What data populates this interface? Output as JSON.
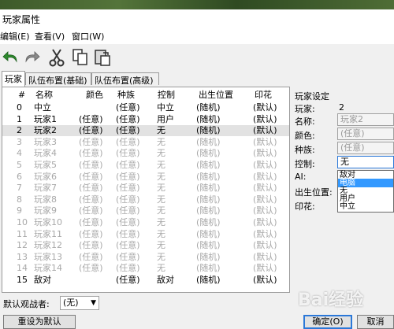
{
  "window": {
    "title": "玩家属性"
  },
  "menu": [
    "编辑(E)",
    "查看(V)",
    "窗口(W)"
  ],
  "toolbar": {
    "icons": [
      "undo-icon",
      "redo-icon",
      "cut-icon",
      "copy-icon",
      "paste-icon"
    ]
  },
  "tabs": [
    "玩家",
    "队伍布置(基础)",
    "队伍布置(高级)"
  ],
  "table": {
    "headers": [
      "#",
      "名称",
      "颜色",
      "种族",
      "控制",
      "出生位置",
      "印花"
    ],
    "rows": [
      {
        "num": "0",
        "name": "中立",
        "color": "",
        "race": "(任意)",
        "control": "中立",
        "start": "(随机)",
        "decal": "(默认)"
      },
      {
        "num": "1",
        "name": "玩家1",
        "color": "(任意)",
        "race": "(任意)",
        "control": "用户",
        "start": "(随机)",
        "decal": "(默认)"
      },
      {
        "num": "2",
        "name": "玩家2",
        "color": "(任意)",
        "race": "(任意)",
        "control": "无",
        "start": "(随机)",
        "decal": "(默认)"
      },
      {
        "num": "3",
        "name": "玩家3",
        "color": "(任意)",
        "race": "(任意)",
        "control": "无",
        "start": "(随机)",
        "decal": "(默认)"
      },
      {
        "num": "4",
        "name": "玩家4",
        "color": "(任意)",
        "race": "(任意)",
        "control": "无",
        "start": "(随机)",
        "decal": "(默认)"
      },
      {
        "num": "5",
        "name": "玩家5",
        "color": "(任意)",
        "race": "(任意)",
        "control": "无",
        "start": "(随机)",
        "decal": "(默认)"
      },
      {
        "num": "6",
        "name": "玩家6",
        "color": "(任意)",
        "race": "(任意)",
        "control": "无",
        "start": "(随机)",
        "decal": "(默认)"
      },
      {
        "num": "7",
        "name": "玩家7",
        "color": "(任意)",
        "race": "(任意)",
        "control": "无",
        "start": "(随机)",
        "decal": "(默认)"
      },
      {
        "num": "8",
        "name": "玩家8",
        "color": "(任意)",
        "race": "(任意)",
        "control": "无",
        "start": "(随机)",
        "decal": "(默认)"
      },
      {
        "num": "9",
        "name": "玩家9",
        "color": "(任意)",
        "race": "(任意)",
        "control": "无",
        "start": "(随机)",
        "decal": "(默认)"
      },
      {
        "num": "10",
        "name": "玩家10",
        "color": "(任意)",
        "race": "(任意)",
        "control": "无",
        "start": "(随机)",
        "decal": "(默认)"
      },
      {
        "num": "11",
        "name": "玩家11",
        "color": "(任意)",
        "race": "(任意)",
        "control": "无",
        "start": "(随机)",
        "decal": "(默认)"
      },
      {
        "num": "12",
        "name": "玩家12",
        "color": "(任意)",
        "race": "(任意)",
        "control": "无",
        "start": "(随机)",
        "decal": "(默认)"
      },
      {
        "num": "13",
        "name": "玩家13",
        "color": "(任意)",
        "race": "(任意)",
        "control": "无",
        "start": "(随机)",
        "decal": "(默认)"
      },
      {
        "num": "14",
        "name": "玩家14",
        "color": "(任意)",
        "race": "(任意)",
        "control": "无",
        "start": "(随机)",
        "decal": "(默认)"
      },
      {
        "num": "15",
        "name": "敌对",
        "color": "",
        "race": "(任意)",
        "control": "敌对",
        "start": "(随机)",
        "decal": "(默认)"
      }
    ],
    "selected_index": 2,
    "dimmed_from": 3,
    "dimmed_to": 14
  },
  "player_settings": {
    "heading": "玩家设定",
    "player_label": "玩家:",
    "player_value": "2",
    "name_label": "名称:",
    "name_value": "玩家2",
    "color_label": "颜色:",
    "color_value": "(任意)",
    "race_label": "种族:",
    "race_value": "(任意)",
    "control_label": "控制:",
    "control_value": "无",
    "control_options": [
      "敌对",
      "电脑",
      "无",
      "用户",
      "中立"
    ],
    "control_highlight": "电脑",
    "ai_label": "AI:",
    "start_label": "出生位置:",
    "decal_label": "印花:"
  },
  "bottom": {
    "observer_label": "默认观战者:",
    "observer_value": "(无)",
    "reset_button": "重设为默认",
    "ok_button": "确定(O)",
    "cancel_button": "取消"
  },
  "watermark": "Bai经验"
}
